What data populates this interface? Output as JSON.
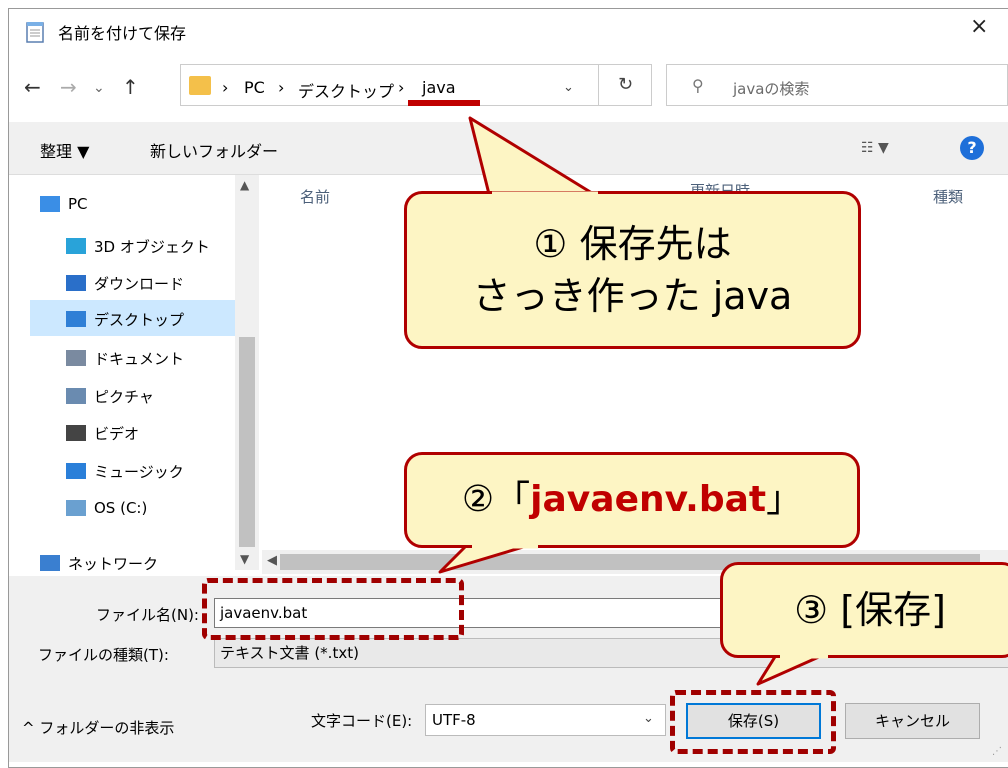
{
  "window": {
    "title": "名前を付けて保存",
    "close": "×"
  },
  "address": {
    "segments": [
      "PC",
      "デスクトップ",
      "java"
    ],
    "separator": "›",
    "search_placeholder": "javaの検索"
  },
  "toolbar": {
    "organize": "整理 ▼",
    "new_folder": "新しいフォルダー",
    "view": "☷ ▼",
    "help": "?"
  },
  "nav": {
    "items": [
      {
        "label": "PC",
        "icon": "pc-icon"
      },
      {
        "label": "3D オブジェクト",
        "icon": "3d-objects-icon"
      },
      {
        "label": "ダウンロード",
        "icon": "download-icon"
      },
      {
        "label": "デスクトップ",
        "icon": "desktop-icon",
        "selected": true
      },
      {
        "label": "ドキュメント",
        "icon": "document-icon"
      },
      {
        "label": "ピクチャ",
        "icon": "picture-icon"
      },
      {
        "label": "ビデオ",
        "icon": "video-icon"
      },
      {
        "label": "ミュージック",
        "icon": "music-icon"
      },
      {
        "label": "OS (C:)",
        "icon": "drive-icon"
      },
      {
        "label": "ネットワーク",
        "icon": "network-icon"
      }
    ]
  },
  "columns": {
    "name": "名前",
    "date": "更新日時",
    "type": "種類"
  },
  "form": {
    "filename_label": "ファイル名(N):",
    "filename_value": "javaenv.bat",
    "filetype_label": "ファイルの種類(T):",
    "filetype_value": "テキスト文書 (*.txt)",
    "hide_folders": "^ フォルダーの非表示",
    "encoding_label": "文字コード(E):",
    "encoding_value": "UTF-8",
    "save_button": "保存(S)",
    "cancel_button": "キャンセル"
  },
  "callouts": {
    "c1_line1": "① 保存先は",
    "c1_line2": "さっき作った java",
    "c2_prefix": "②「",
    "c2_name": "javaenv.bat",
    "c2_suffix": "」",
    "c3": "③ [保存]"
  },
  "colors": {
    "accent": "#0078d7",
    "annotation": "#c00000",
    "callout_fill": "#fdf5c4"
  }
}
